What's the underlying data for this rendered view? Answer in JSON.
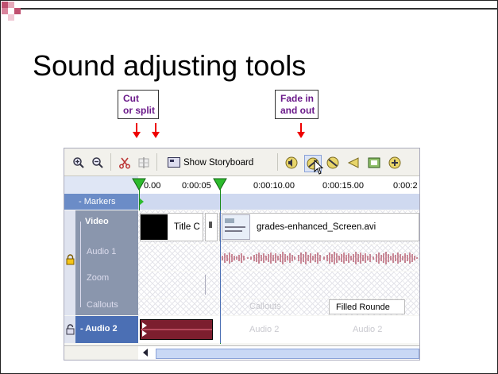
{
  "slide": {
    "title": "Sound adjusting tools"
  },
  "callouts": {
    "cut": "Cut\nor split",
    "fade": "Fade in\nand out"
  },
  "toolbar": {
    "show_storyboard": "Show Storyboard"
  },
  "ruler": {
    "ticks": [
      "0.00",
      "0:00:05",
      "0:00:10.00",
      "0:00:15.00",
      "0:00:2"
    ]
  },
  "tracks": {
    "markers": "- Markers",
    "video": "Video",
    "audio1": "Audio 1",
    "zoom": "Zoom",
    "callouts": "Callouts",
    "audio2": "- Audio 2"
  },
  "clips": {
    "title_clip": "Title C",
    "video_clip": "grades-enhanced_Screen.avi",
    "callout_ghost": "Callouts",
    "filled_rounded": "Filled Rounde",
    "audio2_ghost_1": "Audio 2",
    "audio2_ghost_2": "Audio 2"
  },
  "colors": {
    "callout_text": "#6b1a8a",
    "arrow": "#ee0000",
    "track_header": "#6b8cc7",
    "waveform": "#9b1b35",
    "playhead": "#1a8a1a"
  }
}
